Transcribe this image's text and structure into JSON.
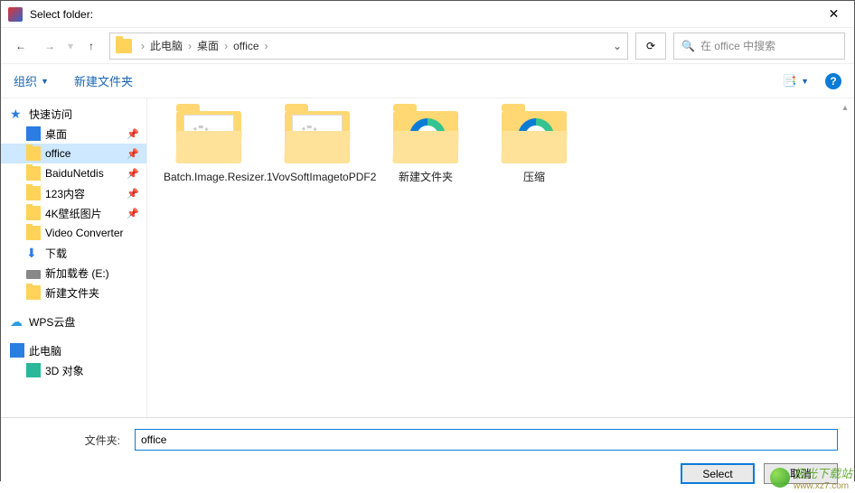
{
  "window": {
    "title": "Select folder:"
  },
  "breadcrumb": {
    "root_sep": "›",
    "items": [
      "此电脑",
      "桌面",
      "office"
    ]
  },
  "search": {
    "placeholder": "在 office 中搜索"
  },
  "toolbar": {
    "organize": "组织",
    "new_folder": "新建文件夹"
  },
  "sidebar": {
    "quick_access": "快速访问",
    "items": [
      {
        "label": "桌面",
        "pinned": true
      },
      {
        "label": "office",
        "pinned": true,
        "selected": true
      },
      {
        "label": "BaiduNetdis",
        "pinned": true
      },
      {
        "label": "123内容",
        "pinned": true
      },
      {
        "label": "4K壁纸图片",
        "pinned": true
      },
      {
        "label": "Video Converter",
        "pinned": false
      },
      {
        "label": "下载",
        "pinned": false
      },
      {
        "label": "新加载卷 (E:)",
        "pinned": false
      },
      {
        "label": "新建文件夹",
        "pinned": false
      }
    ],
    "wps": "WPS云盘",
    "this_pc": "此电脑",
    "three_d": "3D 对象"
  },
  "folders": [
    {
      "name": "Batch.Image.Resizer.1",
      "type": "gear"
    },
    {
      "name": "VovSoftImagetoPDF2",
      "type": "gear"
    },
    {
      "name": "新建文件夹",
      "type": "edge"
    },
    {
      "name": "压缩",
      "type": "edge"
    }
  ],
  "footer": {
    "label": "文件夹:",
    "value": "office",
    "select": "Select",
    "cancel": "取消"
  },
  "watermark": {
    "text": "极光下载站",
    "url": "www.xz7.com"
  }
}
